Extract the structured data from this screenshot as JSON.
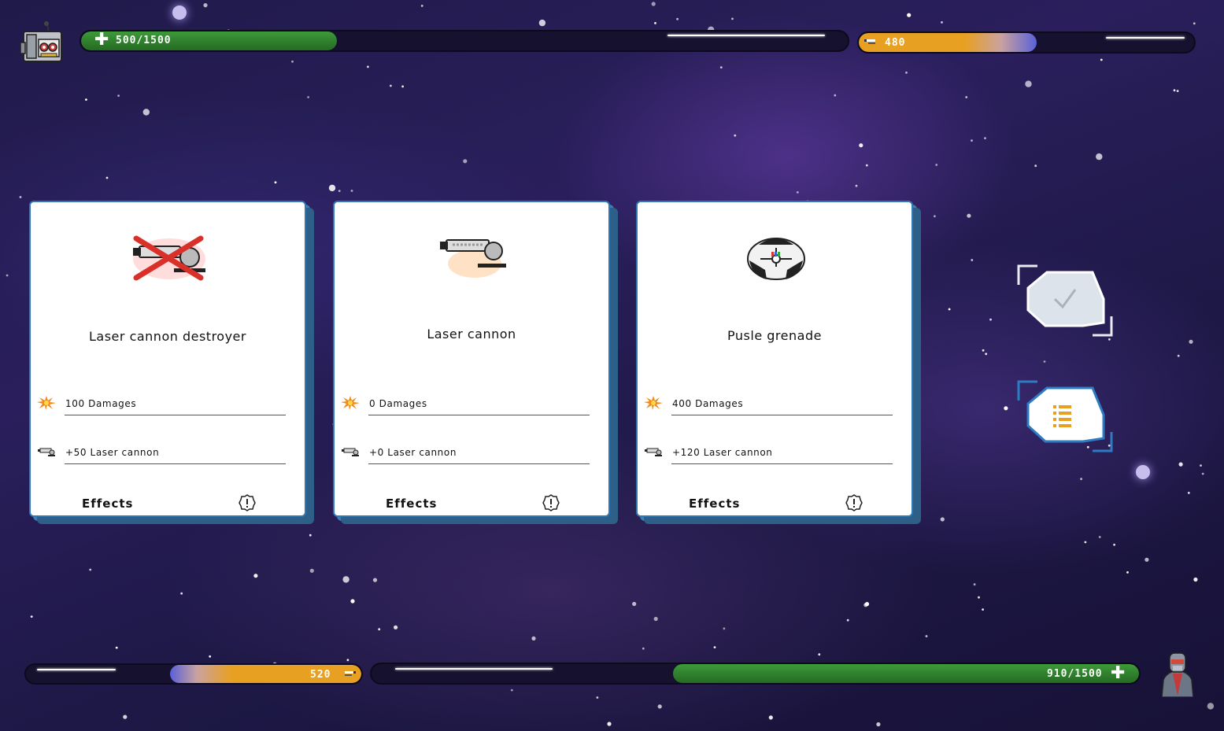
{
  "player_top": {
    "health_text": "500/1500",
    "health_fraction": 0.3333,
    "energy_text": "480",
    "energy_fraction": 0.53
  },
  "player_bottom": {
    "energy_text": "520",
    "energy_fraction": 0.57,
    "health_text": "910/1500",
    "health_fraction": 0.607
  },
  "cards": [
    {
      "title": "Laser cannon destroyer",
      "art_icon": "laser-cannon-crossed-icon",
      "damage_text": "100 Damages",
      "laser_text": "+50 Laser cannon",
      "effects_label": "Effects"
    },
    {
      "title": "Laser cannon",
      "art_icon": "laser-cannon-icon",
      "damage_text": "0 Damages",
      "laser_text": "+0 Laser cannon",
      "effects_label": "Effects"
    },
    {
      "title": "Pusle grenade",
      "art_icon": "pulse-grenade-icon",
      "damage_text": "400 Damages",
      "laser_text": "+120 Laser cannon",
      "effects_label": "Effects"
    }
  ],
  "buttons": {
    "confirm_icon": "checkmark-icon",
    "list_icon": "list-icon"
  },
  "colors": {
    "health_green": "#2f7f2d",
    "energy_orange": "#e8a023",
    "card_border": "#2f78b3",
    "button_fill": "#dde3ea"
  }
}
